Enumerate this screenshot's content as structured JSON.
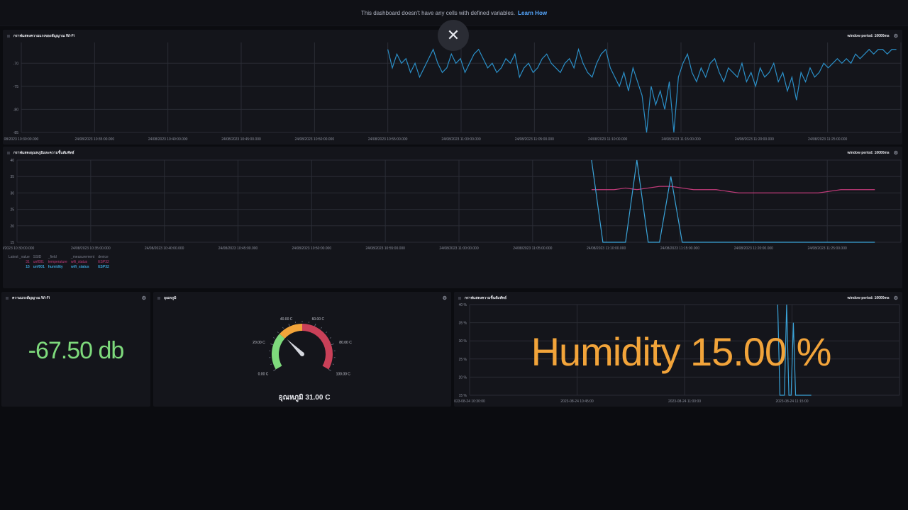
{
  "banner": {
    "text": "This dashboard doesn't have any cells with defined variables.",
    "link": "Learn How"
  },
  "close_icon": "close-icon",
  "colors": {
    "wifi_line": "#2b8fc7",
    "temperature": "#c33b7a",
    "humidity": "#3aa3d8",
    "stat_green": "#7eda7c",
    "stat_orange": "#f2a43a"
  },
  "cell_wifi": {
    "title": "กราฟแสดงความแรงของสัญญาณ Wi-Fi",
    "window_period": "window period: 10000ms",
    "y_ticks": [
      "-70",
      "-75",
      "-80",
      "-85"
    ],
    "x_ticks": [
      "24/08/2023 10:30:00.000",
      "24/08/2023 10:35:00.000",
      "24/08/2023 10:40:00.000",
      "24/08/2023 10:45:00.000",
      "24/08/2023 10:50:00.000",
      "24/08/2023 10:55:00.000",
      "24/08/2023 11:00:00.000",
      "24/08/2023 11:05:00.000",
      "24/08/2023 11:10:00.000",
      "24/08/2023 11:15:00.000",
      "24/08/2023 11:20:00.000",
      "24/08/2023 11:25:00.000"
    ],
    "x_tick_visible": [
      "08/2023 10:30:00.000",
      "24/08/2023 10:35:00.000",
      "24/08/2023 10:40:00.000",
      "24/08/2023 10:45:00.000",
      "24/08/2023 10:50:00.000",
      "24/08/2023 10:55:00.000",
      "24/08/2023 11:00:00.000",
      "24/08/2023 11:05:00.000",
      "24/08/2023 11:10:00.000",
      "24/08/2023 11:15:00.000",
      "24/08/2023 11:20:00.000",
      "24/08/2023 11:25:00.000"
    ]
  },
  "cell_temp_hum": {
    "title": "กราฟแสดงอุณหภูมิและความชื้นสัมพัทธ์",
    "window_period": "window period: 10000ms",
    "y_ticks": [
      "40",
      "35",
      "30",
      "25",
      "20",
      "15"
    ],
    "x_ticks": [
      "08/2023 10:30:00.000",
      "24/08/2023 10:35:00.000",
      "24/08/2023 10:40:00.000",
      "24/08/2023 10:45:00.000",
      "24/08/2023 10:50:00.000",
      "24/08/2023 10:55:00.000",
      "24/08/2023 11:00:00.000",
      "24/08/2023 11:05:00.000",
      "24/08/2023 11:10:00.000",
      "24/08/2023 11:15:00.000",
      "24/08/2023 11:20:00.000",
      "24/08/2023 11:25:00.000"
    ],
    "legend_headers": [
      "Latest _value",
      "SSID",
      "_field",
      "_measurement",
      "device"
    ],
    "legend_rows": [
      {
        "value": "31",
        "ssid": "unf001",
        "field": "temperature",
        "measurement": "wifi_status",
        "device": "ESP32"
      },
      {
        "value": "15",
        "ssid": "unf001",
        "field": "humidity",
        "measurement": "wifi_status",
        "device": "ESP32"
      }
    ]
  },
  "cell_signal": {
    "title": "ความแรงสัญญาณ Wi-Fi",
    "value": "-67.50 db"
  },
  "cell_gauge": {
    "title": "อุณหภูมิ",
    "labels": [
      "0.00 C",
      "20.00 C",
      "40.00 C",
      "60.00 C",
      "80.00 C",
      "100.00 C"
    ],
    "reading": "อุณหภูมิ 31.00 C",
    "value": 31,
    "min": 0,
    "max": 100
  },
  "cell_humidity": {
    "title": "กราฟแสดงความชื้นสัมพัทธ์",
    "window_period": "window period: 10000ms",
    "y_ticks": [
      "40 %",
      "35 %",
      "30 %",
      "25 %",
      "20 %",
      "15 %"
    ],
    "x_ticks": [
      "023-08-24 10:30:00",
      "2023-08-24 10:45:00",
      "2023-08-24 11:00:00",
      "2023-08-24 11:15:00"
    ],
    "overlay": "Humidity 15.00 %"
  },
  "chart_data": [
    {
      "type": "line",
      "title": "กราฟแสดงความแรงของสัญญาณ Wi-Fi",
      "x_range": [
        "2023-08-24 10:30",
        "2023-08-24 11:30"
      ],
      "ylim": [
        -85,
        -66
      ],
      "series": [
        {
          "values_start": "10:55",
          "values": [
            -67,
            -71,
            -68,
            -70,
            -69,
            -72,
            -70,
            -73,
            -71,
            -69,
            -67,
            -70,
            -72,
            -71,
            -68,
            -70,
            -69,
            -72,
            -70,
            -68,
            -67,
            -69,
            -71,
            -70,
            -72,
            -71,
            -69,
            -70,
            -68,
            -73,
            -71,
            -70,
            -72,
            -71,
            -69,
            -68,
            -70,
            -71,
            -72,
            -70,
            -69,
            -71,
            -67,
            -70,
            -72,
            -73,
            -70,
            -68,
            -67,
            -71,
            -73,
            -75,
            -72,
            -76,
            -71,
            -74,
            -77,
            -85,
            -75,
            -79,
            -76,
            -80,
            -74,
            -85,
            -73,
            -70,
            -68,
            -72,
            -74,
            -71,
            -73,
            -70,
            -69,
            -72,
            -74,
            -71,
            -72,
            -73,
            -70,
            -74,
            -72,
            -75,
            -71,
            -73,
            -72,
            -70,
            -74,
            -72,
            -76,
            -73,
            -78,
            -72,
            -74,
            -71,
            -73,
            -72,
            -70,
            -71,
            -70,
            -69,
            -70,
            -69,
            -70,
            -68,
            -69,
            -68,
            -67,
            -68,
            -67,
            -67,
            -68,
            -67,
            -67
          ]
        }
      ]
    },
    {
      "type": "line",
      "title": "กราฟแสดงอุณหภูมิและความชื้นสัมพัทธ์",
      "x_range": [
        "2023-08-24 10:30",
        "2023-08-24 11:30"
      ],
      "ylim": [
        15,
        40
      ],
      "series": [
        {
          "name": "temperature",
          "values_start": "11:09",
          "values": [
            31,
            31,
            31,
            31.5,
            31,
            31.5,
            32,
            32,
            31.5,
            31,
            31,
            31,
            30.5,
            30,
            30,
            30,
            30,
            30,
            30,
            30,
            30,
            30.5,
            31,
            31,
            31,
            31
          ]
        },
        {
          "name": "humidity",
          "values_start": "11:09",
          "values": [
            40,
            15,
            15,
            15,
            40,
            15,
            15,
            35,
            15,
            15,
            15,
            15,
            15,
            15,
            15,
            15,
            15,
            15,
            15,
            15,
            15,
            15,
            15,
            15,
            15,
            15
          ]
        }
      ]
    },
    {
      "type": "line",
      "title": "กราฟแสดงความชื้นสัมพัทธ์",
      "x_range": [
        "2023-08-24 10:30",
        "2023-08-24 11:30"
      ],
      "ylim": [
        15,
        40
      ],
      "series": [
        {
          "name": "humidity",
          "values_start": "11:09",
          "values": [
            40,
            15,
            15,
            15,
            40,
            15,
            15,
            35,
            15,
            15,
            15,
            15,
            15,
            15,
            15,
            15
          ]
        }
      ]
    }
  ]
}
